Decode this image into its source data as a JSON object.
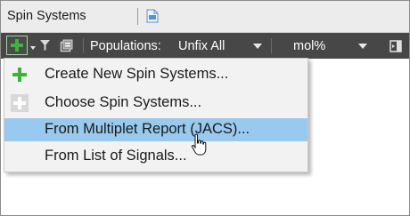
{
  "window": {
    "title": "Spin Systems"
  },
  "toolbar": {
    "populations_label": "Populations:",
    "populations_value": "Unfix All",
    "units_value": "mol%"
  },
  "menu": {
    "items": [
      {
        "label": "Create New Spin Systems...",
        "icon": "plus-icon"
      },
      {
        "label": "Choose Spin Systems...",
        "icon": "plus-icon"
      },
      {
        "label": "From Multiplet Report (JACS)...",
        "icon": "none",
        "highlighted": true
      },
      {
        "label": "From List of Signals...",
        "icon": "none"
      }
    ]
  },
  "colors": {
    "toolbar_bg": "#474747",
    "highlight": "#99c9ef",
    "add_green": "#3cb43c",
    "menu_bg": "#f2f2f2"
  }
}
